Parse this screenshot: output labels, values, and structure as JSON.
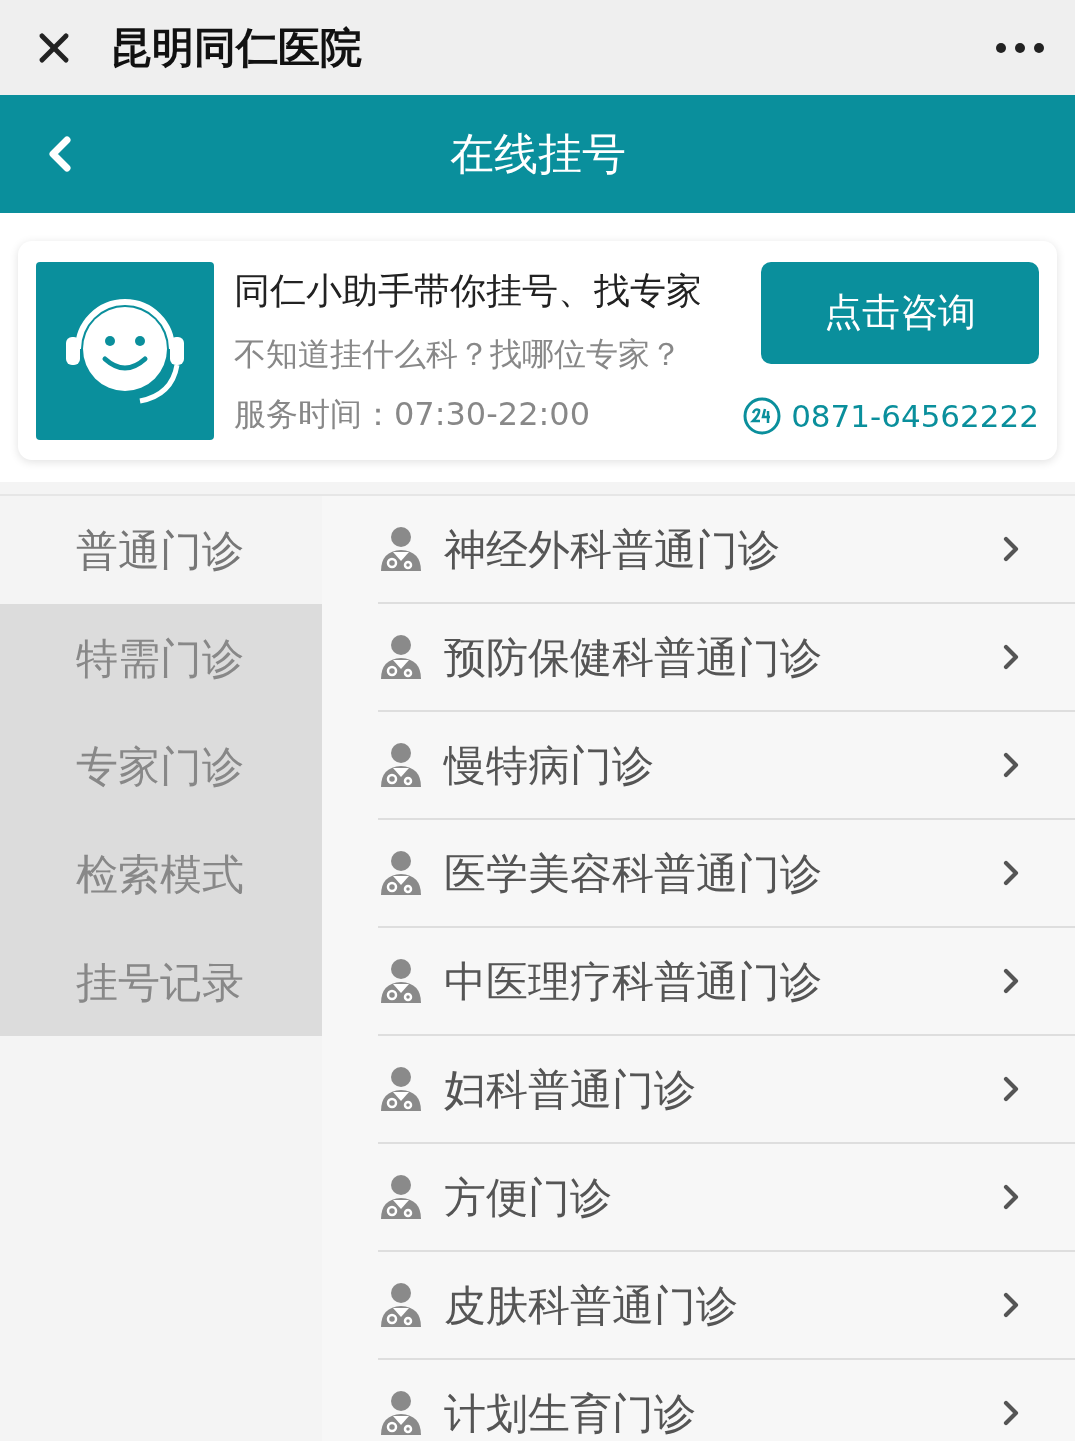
{
  "window": {
    "title": "昆明同仁医院"
  },
  "header": {
    "title": "在线挂号"
  },
  "assistant": {
    "title": "同仁小助手带你挂号、找专家",
    "subtitle": "不知道挂什么科？找哪位专家？",
    "hours": "服务时间：07:30-22:00",
    "button": "点击咨询",
    "phone": "0871-64562222"
  },
  "sidebar": {
    "items": [
      {
        "label": "普通门诊",
        "selected": true
      },
      {
        "label": "特需门诊",
        "selected": false
      },
      {
        "label": "专家门诊",
        "selected": false
      },
      {
        "label": "检索模式",
        "selected": false
      },
      {
        "label": "挂号记录",
        "selected": false
      }
    ]
  },
  "departments": [
    {
      "label": "神经外科普通门诊"
    },
    {
      "label": "预防保健科普通门诊"
    },
    {
      "label": "慢特病门诊"
    },
    {
      "label": "医学美容科普通门诊"
    },
    {
      "label": "中医理疗科普通门诊"
    },
    {
      "label": "妇科普通门诊"
    },
    {
      "label": "方便门诊"
    },
    {
      "label": "皮肤科普通门诊"
    },
    {
      "label": "计划生育门诊"
    }
  ]
}
